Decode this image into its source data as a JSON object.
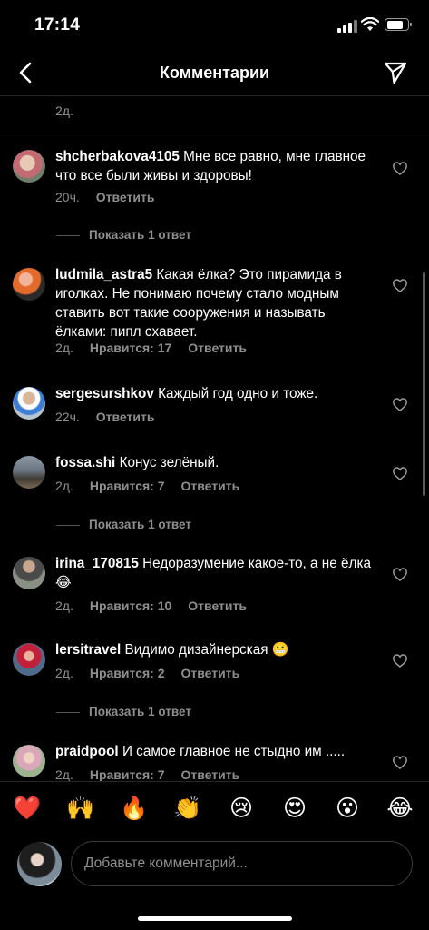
{
  "status_bar": {
    "time": "17:14",
    "battery_level": 0.85
  },
  "nav": {
    "title": "Комментарии",
    "back_icon": "chevron-left-icon",
    "send_icon": "paper-plane-icon"
  },
  "top_comment_meta": {
    "time": "2д."
  },
  "comments": [
    {
      "username": "shcherbakova4105",
      "text": "Мне все равно, мне главное что все были живы и здоровы!",
      "time": "20ч.",
      "likes": "",
      "reply_label": "Ответить",
      "show_replies": "Показать 1 ответ"
    },
    {
      "username": "ludmila_astra5",
      "text": "Какая ёлка? Это пирамида в иголках. Не понимаю почему стало модным ставить вот такие сооружения и называть ёлками: пипл схавает.",
      "time": "2д.",
      "likes": "Нравится: 17",
      "reply_label": "Ответить"
    },
    {
      "username": "sergesurshkov",
      "text": "Каждый год одно и тоже.",
      "time": "22ч.",
      "likes": "",
      "reply_label": "Ответить"
    },
    {
      "username": "fossa.shi",
      "text": "Конус зелёный.",
      "time": "2д.",
      "likes": "Нравится: 7",
      "reply_label": "Ответить",
      "show_replies": "Показать 1 ответ"
    },
    {
      "username": "irina_170815",
      "text": "Недоразумение какое-то, а не ёлка 😂",
      "time": "2д.",
      "likes": "Нравится: 10",
      "reply_label": "Ответить"
    },
    {
      "username": "lersitravel",
      "text": "Видимо дизайнерская 😬",
      "time": "2д.",
      "likes": "Нравится: 2",
      "reply_label": "Ответить",
      "show_replies": "Показать 1 ответ"
    },
    {
      "username": "praidpool",
      "text": "И самое главное не стыдно им .....",
      "time": "2д.",
      "likes": "Нравится: 7",
      "reply_label": "Ответить"
    }
  ],
  "emoji_bar": [
    "❤️",
    "🙌",
    "🔥",
    "👏",
    "😢",
    "😍",
    "😮",
    "😂"
  ],
  "composer": {
    "placeholder": "Добавьте комментарий..."
  },
  "colors": {
    "background": "#000000",
    "secondary_text": "#8e8e8e",
    "divider": "#262626"
  }
}
